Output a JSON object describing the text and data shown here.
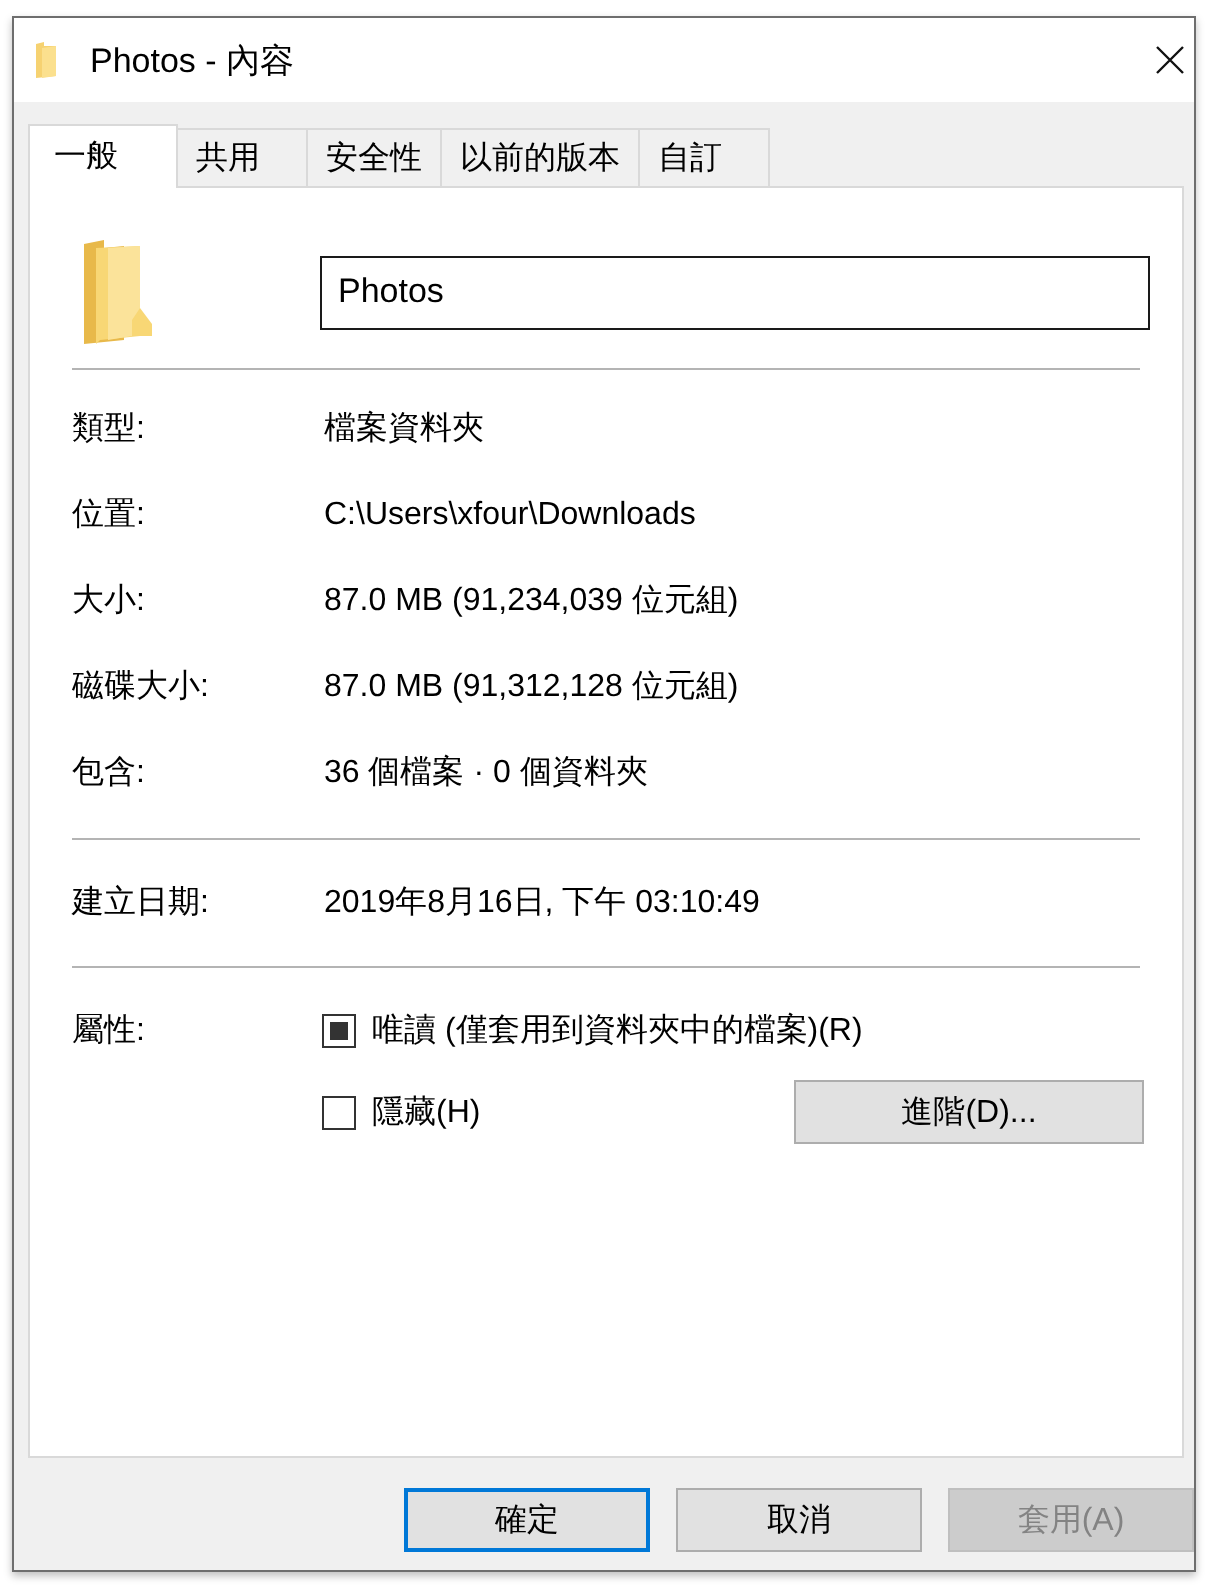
{
  "window": {
    "title": "Photos - 內容"
  },
  "tabs": [
    {
      "label": "一般",
      "selected": true
    },
    {
      "label": "共用",
      "selected": false
    },
    {
      "label": "安全性",
      "selected": false
    },
    {
      "label": "以前的版本",
      "selected": false
    },
    {
      "label": "自訂",
      "selected": false
    }
  ],
  "name_field": {
    "value": "Photos"
  },
  "info_groups": [
    [
      {
        "label": "類型:",
        "value": "檔案資料夾"
      },
      {
        "label": "位置:",
        "value": "C:\\Users\\xfour\\Downloads"
      },
      {
        "label": "大小:",
        "value": "87.0 MB (91,234,039 位元組)"
      },
      {
        "label": "磁碟大小:",
        "value": "87.0 MB (91,312,128 位元組)"
      },
      {
        "label": "包含:",
        "value": "36 個檔案 · 0 個資料夾"
      }
    ],
    [
      {
        "label": "建立日期:",
        "value": "2019年8月16日, 下午 03:10:49"
      }
    ]
  ],
  "attributes": {
    "label": "屬性:",
    "options": [
      {
        "label": "唯讀 (僅套用到資料夾中的檔案)(R)",
        "checked": false,
        "indeterminate": true
      },
      {
        "label": "隱藏(H)",
        "checked": false,
        "indeterminate": false
      }
    ],
    "advanced_button": "進階(D)..."
  },
  "buttons": [
    {
      "label": "確定",
      "default": true,
      "disabled": false
    },
    {
      "label": "取消",
      "default": false,
      "disabled": false
    },
    {
      "label": "套用(A)",
      "default": false,
      "disabled": true
    }
  ]
}
